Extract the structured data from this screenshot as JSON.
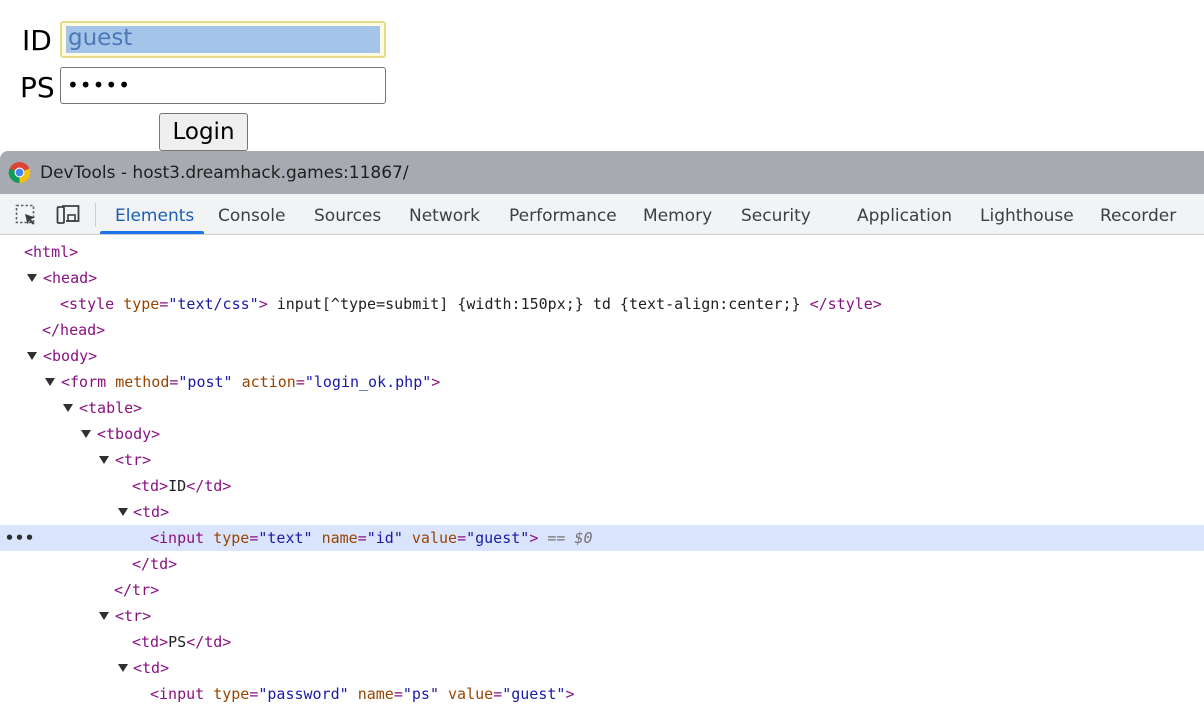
{
  "page": {
    "id_label": "ID",
    "ps_label": "PS",
    "id_value": "guest",
    "ps_value": "•••••",
    "login_button": "Login"
  },
  "devtools": {
    "title": "DevTools - host3.dreamhack.games:11867/",
    "tabs": [
      "Elements",
      "Console",
      "Sources",
      "Network",
      "Performance",
      "Memory",
      "Security",
      "Application",
      "Lighthouse",
      "Recorder"
    ],
    "active_tab": "Elements",
    "accent_color": "#1a73e8",
    "icons": [
      "chrome-logo-icon",
      "inspect-element-icon",
      "device-toolbar-icon"
    ],
    "dom_tree": {
      "html_open": "<html>",
      "head_open": "<head>",
      "style_open_tag": "<style",
      "style_attr_name": "type",
      "style_attr_value": "\"text/css\"",
      "style_close_bracket": ">",
      "style_content": " input[^type=submit] {width:150px;} td {text-align:center;} ",
      "style_end_tag": "</style>",
      "head_close": "</head>",
      "body_open": "<body>",
      "form_open_tag": "<form",
      "form_attr1_name": "method",
      "form_attr1_value": "\"post\"",
      "form_attr2_name": "action",
      "form_attr2_value": "\"login_ok.php\"",
      "form_close_bracket": ">",
      "table_open": "<table>",
      "tbody_open": "<tbody>",
      "tr1_open": "<tr>",
      "td_id_open": "<td>",
      "td_id_text": "ID",
      "td_id_close": "</td>",
      "td2_open": "<td>",
      "input1_open_tag": "<input",
      "input1_type_name": "type",
      "input1_type_value": "\"text\"",
      "input1_name_name": "name",
      "input1_name_value": "\"id\"",
      "input1_value_name": "value",
      "input1_value_value": "\"guest\"",
      "input1_close_bracket": ">",
      "selected_marker": "== $0",
      "td2_close": "</td>",
      "tr1_close": "</tr>",
      "tr2_open": "<tr>",
      "td_ps_open": "<td>",
      "td_ps_text": "PS",
      "td_ps_close": "</td>",
      "td3_open": "<td>",
      "input2_open_tag": "<input",
      "input2_type_name": "type",
      "input2_type_value": "\"password\"",
      "input2_name_name": "name",
      "input2_name_value": "\"ps\"",
      "input2_value_name": "value",
      "input2_value_value": "\"guest\"",
      "input2_close_bracket": ">",
      "row_menu": "•••"
    }
  }
}
